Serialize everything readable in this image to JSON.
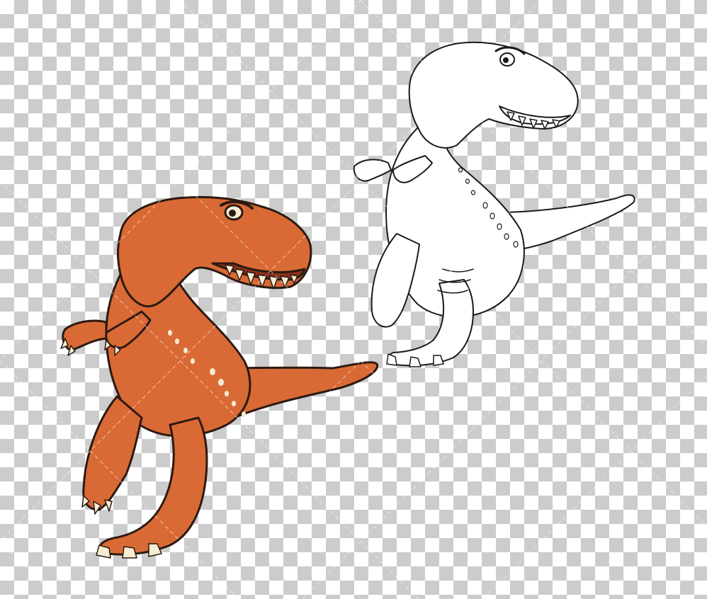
{
  "canvas": {
    "background": "transparency-checkerboard",
    "checker_color": "#cccccc",
    "base_color": "#ffffff"
  },
  "watermark": {
    "style": "diagonal-hatched-grid",
    "color": "#ffffff"
  },
  "figures": [
    {
      "name": "t-rex-colored",
      "description_icon": "t-rex-icon",
      "fill": "#d96a35",
      "shade": "#b8542a",
      "outline": "#2b1a12",
      "teeth": "#f5ecd2",
      "spots": "#f5ecd2"
    },
    {
      "name": "t-rex-line-art",
      "description_icon": "t-rex-outline-icon",
      "fill": "#ffffff",
      "outline": "#1a1a1a"
    }
  ]
}
